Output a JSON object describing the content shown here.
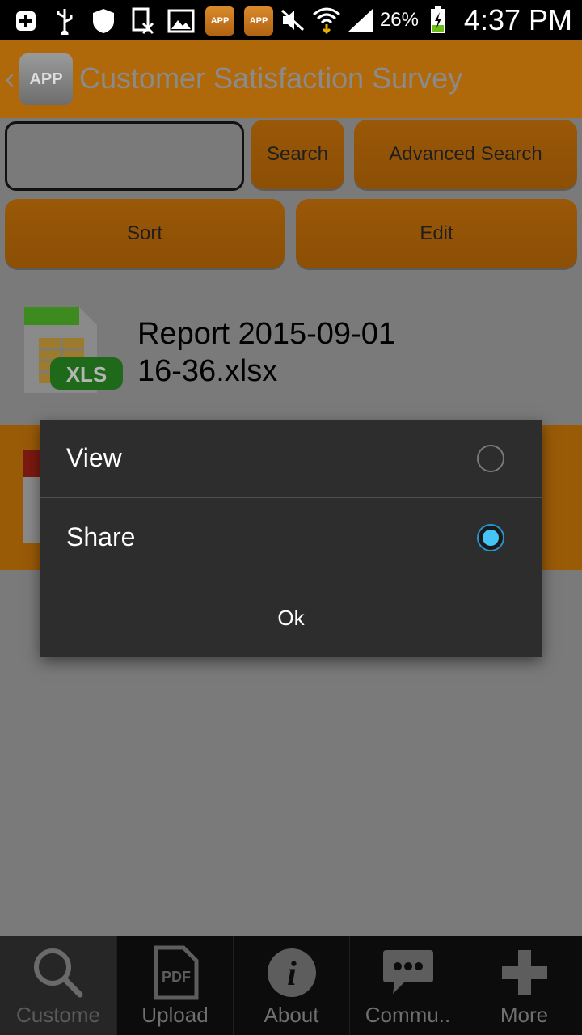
{
  "status_bar": {
    "battery": "26%",
    "time": "4:37 PM",
    "app_icon_text": "APP"
  },
  "header": {
    "logo_text": "APP",
    "title": "Customer Satisfaction Survey"
  },
  "controls": {
    "search_value": "",
    "search_label": "Search",
    "advanced_search_label": "Advanced Search",
    "sort_label": "Sort",
    "edit_label": "Edit"
  },
  "files": [
    {
      "name_line1": "Report 2015-09-01",
      "name_line2": "16-36.xlsx",
      "icon_text": "XLS"
    }
  ],
  "dialog": {
    "options": [
      {
        "label": "View",
        "selected": false
      },
      {
        "label": "Share",
        "selected": true
      }
    ],
    "ok_label": "Ok"
  },
  "bottom_nav": [
    {
      "label": "Custome",
      "icon": "search-icon",
      "active": true
    },
    {
      "label": "Upload",
      "icon": "pdf-icon",
      "active": false
    },
    {
      "label": "About",
      "icon": "info-icon",
      "active": false
    },
    {
      "label": "Commu..",
      "icon": "chat-icon",
      "active": false
    },
    {
      "label": "More",
      "icon": "plus-icon",
      "active": false
    }
  ],
  "colors": {
    "accent_orange": "#9a5b07",
    "radio_blue": "#44c5f5",
    "dialog_bg": "#2d2d2d"
  }
}
